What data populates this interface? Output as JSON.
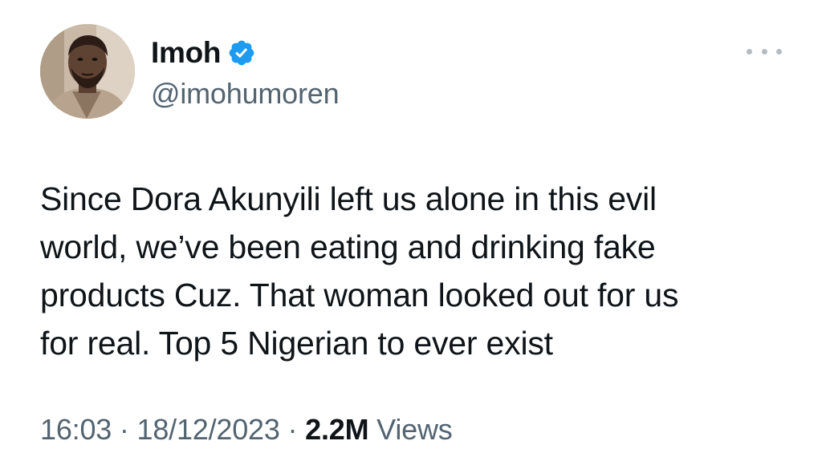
{
  "author": {
    "display_name": "Imoh",
    "handle": "@imohumoren",
    "verified": true
  },
  "tweet": {
    "lines": [
      "Since Dora Akunyili left us alone in this evil",
      "world, we’ve been eating and drinking fake",
      "products Cuz. That woman looked out for us",
      "for real. Top 5 Nigerian to ever exist"
    ],
    "time": "16:03",
    "separator": "·",
    "date": "18/12/2023",
    "views_count": "2.2M",
    "views_label": "Views"
  },
  "icons": {
    "verified": "verified-badge-icon",
    "more": "more-options-icon"
  },
  "colors": {
    "text_primary": "#0f1419",
    "text_secondary": "#536471",
    "verified_blue": "#1d9bf0",
    "dots": "#b4bcc3"
  }
}
